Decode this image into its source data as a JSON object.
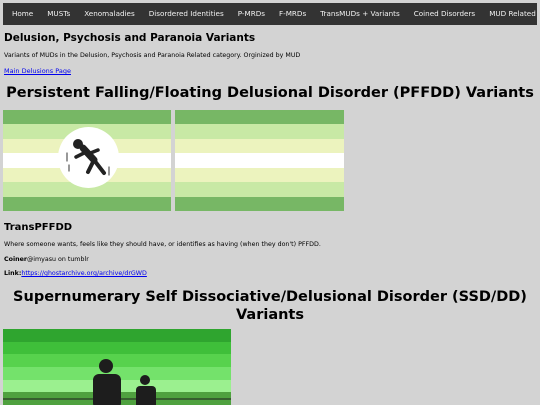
{
  "nav": {
    "items": [
      "Home",
      "MUSTs",
      "Xenomaladies",
      "Disordered Identities",
      "P-MRDs",
      "F-MRDs",
      "TransMUDs + Variants",
      "Coined Disorders",
      "MUD Related"
    ]
  },
  "page": {
    "title": "Delusion, Psychosis and Paranoia Variants",
    "intro": "Variants of MUDs in the Delusion, Psychosis and Paranoia Related category. Orginized by MUD",
    "main_link": "Main Delusions Page"
  },
  "sections": {
    "pffdd": {
      "heading": "Persistent Falling/Floating Delusional Disorder (PFFDD) Variants",
      "flag_colors": [
        "#77b765",
        "#c8e9a5",
        "#ecf3be",
        "#ffffff",
        "#ecf3be",
        "#c8e9a5",
        "#77b765"
      ],
      "variant": {
        "name": "TransPFFDD",
        "description": "Where someone wants, feels like they should have, or identifies as having (when they don't) PFFDD.",
        "coiner_label": "Coiner",
        "coiner_value": "@imyasu on tumblr",
        "link_label": "Link:",
        "link_value": "https://ghostarchive.org/archive/drGWD"
      }
    },
    "ssd": {
      "heading_line1": "Supernumerary Self Dissociative/Delusional Disorder (SSD/DD)",
      "heading_line2": "Variants",
      "flag_colors": [
        "#2fa52f",
        "#3fbf3a",
        "#57d24d",
        "#74e26b",
        "#9bf08f",
        "#4fa13f"
      ]
    }
  }
}
